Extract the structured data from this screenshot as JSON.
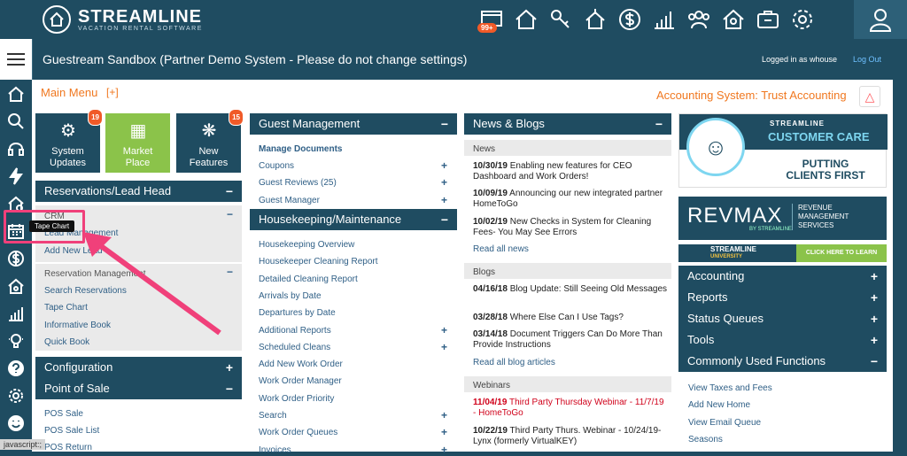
{
  "brand": {
    "name": "STREAMLINE",
    "tagline": "VACATION RENTAL SOFTWARE"
  },
  "top_icons": [
    {
      "name": "alerts-icon",
      "badge": "99+"
    },
    {
      "name": "home-icon"
    },
    {
      "name": "keys-icon"
    },
    {
      "name": "housekeeping-icon"
    },
    {
      "name": "dollar-icon"
    },
    {
      "name": "reports-icon"
    },
    {
      "name": "owners-icon"
    },
    {
      "name": "owner-home-icon"
    },
    {
      "name": "toolbox-icon"
    },
    {
      "name": "settings-icon"
    },
    {
      "name": "user-icon"
    }
  ],
  "header": {
    "title": "Guestream Sandbox (Partner Demo System - Please do not change settings)",
    "logged_in": "Logged in as whouse",
    "logout": "Log Out"
  },
  "main_menu": {
    "label": "Main Menu",
    "toggle": "[+]"
  },
  "accounting_system": "Accounting System: Trust Accounting",
  "tiles": [
    {
      "label1": "System",
      "label2": "Updates",
      "badge": "19",
      "color": "#1f4c61"
    },
    {
      "label1": "Market",
      "label2": "Place",
      "badge": "",
      "color": "#8bc34a"
    },
    {
      "label1": "New",
      "label2": "Features",
      "badge": "15",
      "color": "#1f4c61"
    }
  ],
  "col1": {
    "reservations_title": "Reservations/Lead Head",
    "crm_label": "CRM",
    "crm_items": [
      "Lead Management",
      "Add New Lead"
    ],
    "res_mgmt_label": "Reservation Management",
    "res_items": [
      "Search Reservations",
      "Tape Chart",
      "Informative Book",
      "Quick Book"
    ],
    "configuration": "Configuration",
    "pos_title": "Point of Sale",
    "pos_items": [
      "POS Sale",
      "POS Sale List",
      "POS Return"
    ]
  },
  "col2": {
    "guest_title": "Guest Management",
    "guest_items": [
      {
        "label": "Manage Documents",
        "bold": true,
        "plus": false
      },
      {
        "label": "Coupons",
        "plus": true
      },
      {
        "label": "Guest Reviews (25)",
        "plus": true
      },
      {
        "label": "Guest Manager",
        "plus": true
      }
    ],
    "hk_title": "Housekeeping/Maintenance",
    "hk_items": [
      {
        "label": "Housekeeping Overview",
        "plus": false
      },
      {
        "label": "Housekeeper Cleaning Report",
        "plus": false
      },
      {
        "label": "Detailed Cleaning Report",
        "plus": false
      },
      {
        "label": "Arrivals by Date",
        "plus": false
      },
      {
        "label": "Departures by Date",
        "plus": false
      },
      {
        "label": "Additional Reports",
        "plus": true
      },
      {
        "label": "Scheduled Cleans",
        "plus": true
      },
      {
        "label": "Add New Work Order",
        "plus": false
      },
      {
        "label": "Work Order Manager",
        "plus": false
      },
      {
        "label": "Work Order Priority",
        "plus": false
      },
      {
        "label": "Search",
        "plus": true
      },
      {
        "label": "Work Order Queues",
        "plus": true
      },
      {
        "label": "Invoices",
        "plus": true
      }
    ]
  },
  "col3": {
    "title": "News & Blogs",
    "news_label": "News",
    "news": [
      {
        "date": "10/30/19",
        "text": "Enabling new features for CEO Dashboard and Work Orders!"
      },
      {
        "date": "10/09/19",
        "text": "Announcing our new integrated partner HomeToGo"
      },
      {
        "date": "10/02/19",
        "text": "New Checks in System for Cleaning Fees- You May See Errors"
      }
    ],
    "read_news": "Read all news",
    "blogs_label": "Blogs",
    "blogs": [
      {
        "date": "04/16/18",
        "text": "Blog Update: Still Seeing Old Messages"
      },
      {
        "date": "03/28/18",
        "text": "Where Else Can I Use Tags?"
      },
      {
        "date": "03/14/18",
        "text": "Document Triggers Can Do More Than Provide Instructions"
      }
    ],
    "read_blogs": "Read all blog articles",
    "webinars_label": "Webinars",
    "webinars": [
      {
        "date": "11/04/19",
        "text": "Third Party Thursday Webinar - 11/7/19 - HomeToGo",
        "red": true
      },
      {
        "date": "10/22/19",
        "text": "Third Party Thurs. Webinar - 10/24/19- Lynx (formerly VirtualKEY)",
        "red": false
      }
    ]
  },
  "col4": {
    "ad1": {
      "top": "STREAMLINE",
      "main": "CUSTOMER CARE",
      "sub1": "PUTTING",
      "sub2": "CLIENTS FIRST",
      "ring": "STREAMLINE CUSTOMER CARE"
    },
    "ad2": {
      "brand": "REVMAX",
      "by": "BY STREAMLINE",
      "l1": "REVENUE",
      "l2": "MANAGEMENT",
      "l3": "SERVICES"
    },
    "ad3": {
      "brand": "STREAMLINE",
      "sub": "UNIVERSITY",
      "cta": "CLICK HERE TO LEARN MORE"
    },
    "menu": [
      {
        "label": "Accounting",
        "sign": "+"
      },
      {
        "label": "Reports",
        "sign": "+"
      },
      {
        "label": "Status Queues",
        "sign": "+"
      },
      {
        "label": "Tools",
        "sign": "+"
      },
      {
        "label": "Commonly Used Functions",
        "sign": "−"
      }
    ],
    "functions": [
      "View Taxes and Fees",
      "Add New Home",
      "View Email Queue",
      "Seasons"
    ]
  },
  "tooltip": "Tape Chart",
  "status_bar": "javascript:;"
}
